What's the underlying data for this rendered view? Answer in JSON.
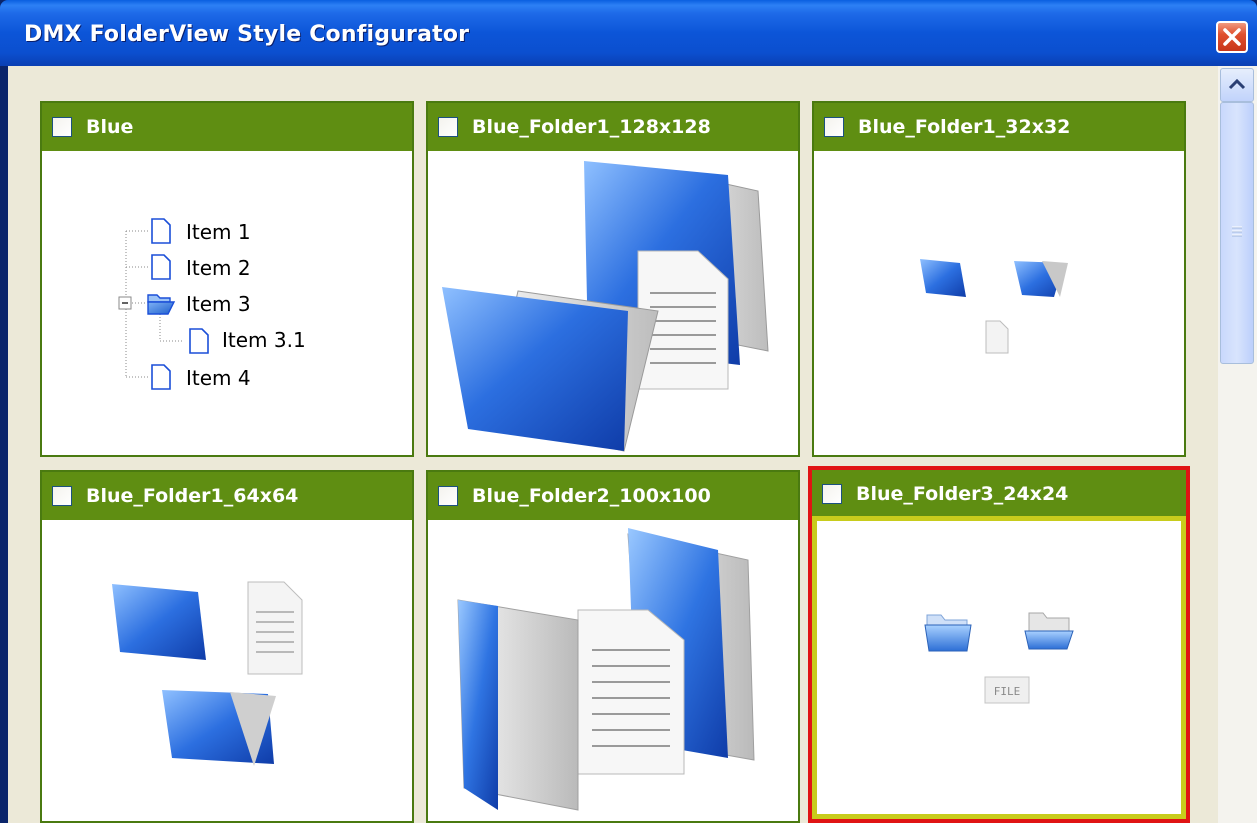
{
  "window": {
    "title": "DMX FolderView Style Configurator"
  },
  "colors": {
    "titlebar": "#0c55d8",
    "card_header": "#5f8e12",
    "selected_border": "#e01414",
    "selected_inner": "#c8cc1c",
    "client_bg": "#ece9d8"
  },
  "styles": [
    {
      "label": "Blue",
      "checked": false,
      "selected": false,
      "preview": "tree"
    },
    {
      "label": "Blue_Folder1_128x128",
      "checked": false,
      "selected": false,
      "preview": "folder1-128"
    },
    {
      "label": "Blue_Folder1_32x32",
      "checked": false,
      "selected": false,
      "preview": "folder1-32"
    },
    {
      "label": "Blue_Folder1_64x64",
      "checked": false,
      "selected": false,
      "preview": "folder1-64"
    },
    {
      "label": "Blue_Folder2_100x100",
      "checked": false,
      "selected": false,
      "preview": "folder2-100"
    },
    {
      "label": "Blue_Folder3_24x24",
      "checked": false,
      "selected": true,
      "preview": "folder3-24"
    }
  ],
  "tree": {
    "items": [
      "Item 1",
      "Item 2",
      "Item 3",
      "Item 3.1",
      "Item 4"
    ]
  },
  "file_icon_text": "FILE"
}
